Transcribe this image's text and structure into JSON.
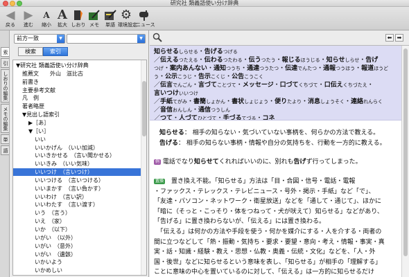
{
  "window": {
    "title": "研究社 類義語使い分け辞典"
  },
  "toolbar": {
    "buttons": [
      {
        "label": "戻る",
        "glyph": "◀"
      },
      {
        "label": "進む",
        "glyph": "▶"
      },
      {
        "label": "縮小",
        "glyph": "A"
      },
      {
        "label": "拡大",
        "glyph": "A"
      },
      {
        "label": "しおり",
        "glyph": "🔖"
      },
      {
        "label": "メモ",
        "glyph": "✎"
      },
      {
        "label": "単語",
        "glyph": "✐"
      },
      {
        "label": "環境設定",
        "glyph": "⚙"
      },
      {
        "label": "ニュース",
        "glyph": "☎"
      }
    ]
  },
  "side_tabs": [
    "索",
    "引",
    "しおりの編集",
    "メモの編集",
    "単",
    "語"
  ],
  "leftpane": {
    "match_mode": "前方一致",
    "search_value": "",
    "tab_search": "検索",
    "tab_index": "索引"
  },
  "tree": [
    {
      "text": "▼研究社 類義語使い分け辞典",
      "indent": 0
    },
    {
      "text": "推薦文　　外山　滋比古",
      "indent": 1
    },
    {
      "text": "前書き",
      "indent": 1
    },
    {
      "text": "主要参考文献",
      "indent": 1
    },
    {
      "text": "凡　例",
      "indent": 1
    },
    {
      "text": "著者略歴",
      "indent": 1
    },
    {
      "text": "▼見出し語索引",
      "indent": 1
    },
    {
      "text": "▶［あ］",
      "indent": 2
    },
    {
      "text": "▼［い］",
      "indent": 2
    },
    {
      "text": "いい",
      "indent": 3
    },
    {
      "text": "いいかげん　（いい加減）",
      "indent": 3
    },
    {
      "text": "いいきかせる　（言い聞かせる）",
      "indent": 3
    },
    {
      "text": "いいきみ　（いい気味）",
      "indent": 3
    },
    {
      "text": "いいつけ　（言いつけ）",
      "indent": 3,
      "selected": true
    },
    {
      "text": "いいつける　（言いつける）",
      "indent": 3
    },
    {
      "text": "いいまかす　（言い負かす）",
      "indent": 3
    },
    {
      "text": "いいわけ　（言い訳）",
      "indent": 3
    },
    {
      "text": "いいわたす　（言い渡す）",
      "indent": 3
    },
    {
      "text": "いう　（言う）",
      "indent": 3
    },
    {
      "text": "いえ　（家）",
      "indent": 3
    },
    {
      "text": "いか　（以下）",
      "indent": 3
    },
    {
      "text": "いがい　（以外）",
      "indent": 3
    },
    {
      "text": "いがい　（意外）",
      "indent": 3
    },
    {
      "text": "いがい　（遺骸）",
      "indent": 3
    },
    {
      "text": "いかいよう",
      "indent": 3
    },
    {
      "text": "いかめしい",
      "indent": 3
    }
  ],
  "header_lines": [
    [
      {
        "b": "知らせる"
      },
      {
        "r": "しらせる"
      },
      {
        "t": "・"
      },
      {
        "b": "告げる"
      },
      {
        "r": "つげる"
      }
    ],
    [
      {
        "t": "／"
      },
      {
        "b": "伝える"
      },
      {
        "r": "つたえる"
      },
      {
        "t": "・"
      },
      {
        "b": "伝わる"
      },
      {
        "r": "つたわる"
      },
      {
        "t": "・"
      },
      {
        "b": "伝う"
      },
      {
        "r": "つたう"
      },
      {
        "t": "・"
      },
      {
        "b": "報じる"
      },
      {
        "r": "ほうじる"
      },
      {
        "t": "・"
      },
      {
        "b": "知らせ"
      },
      {
        "r": "しらせ"
      },
      {
        "t": "・"
      },
      {
        "b": "告げ"
      }
    ],
    [
      {
        "r": "つげ"
      },
      {
        "t": "・"
      },
      {
        "b": "案内あんない"
      },
      {
        "t": "・"
      },
      {
        "b": "通知"
      },
      {
        "r": "つうち"
      },
      {
        "t": "・"
      },
      {
        "b": "通達"
      },
      {
        "r": "つうたつ"
      },
      {
        "t": "・"
      },
      {
        "b": "伝達"
      },
      {
        "r": "でんたつ"
      },
      {
        "t": "・"
      },
      {
        "b": "通報"
      },
      {
        "r": "つうほう"
      },
      {
        "t": "・"
      },
      {
        "b": "報道"
      },
      {
        "r": "ほうど"
      }
    ],
    [
      {
        "r": "う"
      },
      {
        "t": "・"
      },
      {
        "b": "公示"
      },
      {
        "r": "こうじ"
      },
      {
        "t": "・"
      },
      {
        "b": "告示"
      },
      {
        "r": "こくじ"
      },
      {
        "t": "・"
      },
      {
        "b": "公告"
      },
      {
        "r": "こうこく"
      }
    ],
    [
      {
        "t": "／"
      },
      {
        "b": "伝言"
      },
      {
        "r": "でんごん"
      },
      {
        "t": "・"
      },
      {
        "b": "言づて"
      },
      {
        "r": "ことづて"
      },
      {
        "t": "・"
      },
      {
        "b": "メッセージ"
      },
      {
        "t": "・"
      },
      {
        "b": "口づて"
      },
      {
        "r": "くちづて"
      },
      {
        "t": "・"
      },
      {
        "b": "口伝え"
      },
      {
        "r": "くちづたえ"
      },
      {
        "t": "・"
      }
    ],
    [
      {
        "b": "言いつけ"
      },
      {
        "r": "いいつけ"
      }
    ],
    [
      {
        "t": "／"
      },
      {
        "b": "手紙"
      },
      {
        "r": "てがみ"
      },
      {
        "t": "・"
      },
      {
        "b": "書簡"
      },
      {
        "r": "しょかん"
      },
      {
        "t": "・"
      },
      {
        "b": "書状"
      },
      {
        "r": "しょじょう"
      },
      {
        "t": "・"
      },
      {
        "b": "便り"
      },
      {
        "r": "たより"
      },
      {
        "t": "・"
      },
      {
        "b": "消息"
      },
      {
        "r": "しょうそく"
      },
      {
        "t": "・"
      },
      {
        "b": "連絡"
      },
      {
        "r": "れんらく"
      }
    ],
    [
      {
        "t": "／"
      },
      {
        "b": "音信"
      },
      {
        "r": "おんしん"
      },
      {
        "t": "・"
      },
      {
        "b": "通信"
      },
      {
        "r": "つうしん"
      }
    ],
    [
      {
        "t": "／"
      },
      {
        "b": "つて"
      },
      {
        "t": "・"
      },
      {
        "b": "人づて"
      },
      {
        "r": "ひとづて"
      },
      {
        "t": "・"
      },
      {
        "b": "手づる"
      },
      {
        "r": "てづる"
      },
      {
        "t": "・"
      },
      {
        "b": "コネ"
      }
    ]
  ],
  "definitions": [
    {
      "word": "知らせる",
      "text": "相手の知らない・気づいていない事柄を、何らかの方法で教える。"
    },
    {
      "word": "告げる",
      "text": "相手の知らない事柄・情報や自分の気持ちを、行動を一方的に教える。"
    }
  ],
  "example": {
    "badge": "例",
    "parts": [
      {
        "t": "電話でなり"
      },
      {
        "b": "知らせて"
      },
      {
        "t": "くれればいいのに、別れも"
      },
      {
        "b": "告げ"
      },
      {
        "t": "ず行ってしまった。"
      }
    ]
  },
  "usage": {
    "badge": "置換",
    "lines": [
      "置き換え不能。「知らせる」方法は「目・合図・信号・電話・電報",
      "・ファックス・テレックス・テレビニュース・号外・掲示・手紙」など「で」、",
      "「友達・パソコン・ネットワーク・衛星放送」などを「通して・通じて」、ほかに",
      "「暗に（そっと・こっそり・体をつねって・犬が吠えて）知らせる」などがあり、",
      "「告げる」に置き換わらないが、「伝える」には置き換わる。",
      "　「伝える」は何かの方法や手段を使う・何かを媒介にする・人を介する・両者の",
      "間に立つなどして「熱・振動・気持ち・要求・要望・意向・考え・情報・事実・真",
      "実・話・知識・経験・教え・思想・仏教・奥義・伝統・文化」などを、「人・外",
      "国・後世」などに知らせるという意味を表し、「知らせる」が相手の「理解する」",
      "ことに意味の中心を置いているのに対して、「伝える」は一方的に知らせるだけ"
    ]
  },
  "colors": {
    "header_bg": "#dcdcf4",
    "selection": "#3874d8",
    "badge_example": "#a05aa8",
    "badge_usage": "#3a9a4a"
  }
}
